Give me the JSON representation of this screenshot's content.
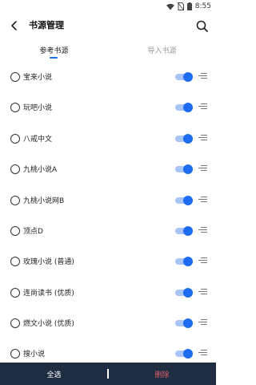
{
  "status_bar": {
    "time": "8:55"
  },
  "header": {
    "title": "书源管理"
  },
  "tabs": [
    {
      "label": "参考书源",
      "active": true
    },
    {
      "label": "导入书源",
      "active": false
    }
  ],
  "sources": [
    {
      "name": "宝来小说",
      "enabled": true
    },
    {
      "name": "玩吧小说",
      "enabled": true
    },
    {
      "name": "八戒中文",
      "enabled": true
    },
    {
      "name": "九桃小说A",
      "enabled": true
    },
    {
      "name": "九桃小说网B",
      "enabled": true
    },
    {
      "name": "顶点D",
      "enabled": true
    },
    {
      "name": "玫瑰小说 (普通)",
      "enabled": true
    },
    {
      "name": "连尚读书 (优质)",
      "enabled": true
    },
    {
      "name": "燃文小说 (优质)",
      "enabled": true
    },
    {
      "name": "搜小说",
      "enabled": true
    }
  ],
  "bottom_bar": {
    "select_all": "全选",
    "delete": "删除"
  },
  "colors": {
    "accent": "#1e6cf2",
    "bottom_bar": "#1f2d42",
    "delete": "#e0606a"
  }
}
